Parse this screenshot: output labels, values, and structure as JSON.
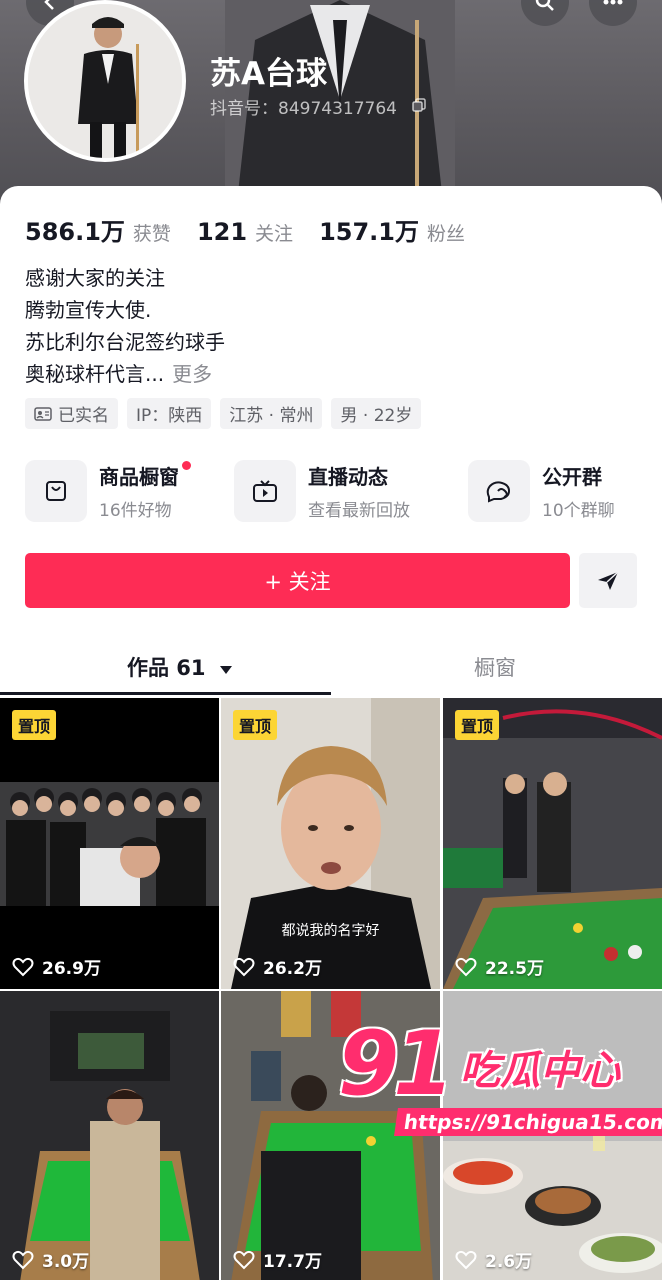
{
  "profile": {
    "name": "苏A台球",
    "douyin_id": "抖音号：84974317764"
  },
  "stats": [
    {
      "value": "586.1万",
      "label": "获赞"
    },
    {
      "value": "121",
      "label": "关注"
    },
    {
      "value": "157.1万",
      "label": "粉丝"
    }
  ],
  "bio": {
    "lines": [
      "感谢大家的关注",
      "腾勃宣传大使.",
      "苏比利尔台泥签约球手",
      "奥秘球杆代言..."
    ],
    "more": "更多"
  },
  "tags": [
    "已实名",
    "IP：陕西",
    "江苏 · 常州",
    "男 · 22岁"
  ],
  "features": [
    {
      "title": "商品橱窗",
      "subtitle": "16件好物",
      "icon": "bag-icon"
    },
    {
      "title": "直播动态",
      "subtitle": "查看最新回放",
      "icon": "tv-icon"
    },
    {
      "title": "公开群",
      "subtitle": "10个群聊",
      "icon": "chat-icon"
    }
  ],
  "actions": {
    "follow_label": "+ 关注"
  },
  "tabs": {
    "works": "作品 61",
    "window": "橱窗"
  },
  "videos": [
    {
      "pinned": "置顶",
      "likes": "26.9万",
      "caption": ""
    },
    {
      "pinned": "置顶",
      "likes": "26.2万",
      "caption": "都说我的名字好"
    },
    {
      "pinned": "置顶",
      "likes": "22.5万",
      "caption": ""
    },
    {
      "pinned": "",
      "likes": "3.0万",
      "caption": ""
    },
    {
      "pinned": "",
      "likes": "17.7万",
      "caption": ""
    },
    {
      "pinned": "",
      "likes": "2.6万",
      "caption": ""
    }
  ],
  "watermark": {
    "number": "91",
    "title": "吃瓜中心",
    "url": "https://91chigua15.com"
  },
  "colors": {
    "accent": "#fe2c55",
    "pin": "#fcd535"
  }
}
